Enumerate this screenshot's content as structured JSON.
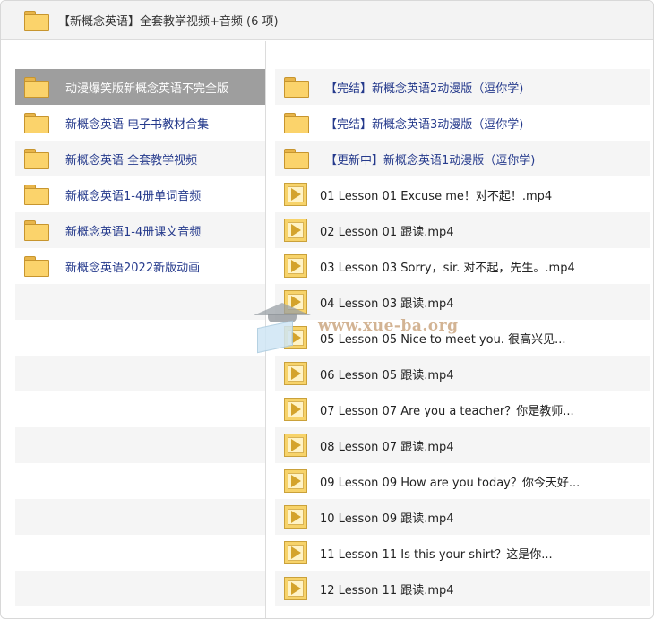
{
  "header": {
    "title": "【新概念英语】全套教学视频+音频 (6 项)",
    "icon": "folder-icon"
  },
  "colors": {
    "folder_fill": "#fbd36b",
    "folder_border": "#c7952e",
    "link_text": "#253a8c",
    "selected_bg": "#9e9e9e",
    "alt_row_bg": "#f5f5f5"
  },
  "left_pane": {
    "items": [
      {
        "label": "动漫爆笑版新概念英语不完全版",
        "icon": "folder-icon",
        "selected": true
      },
      {
        "label": "新概念英语 电子书教材合集",
        "icon": "folder-icon"
      },
      {
        "label": "新概念英语 全套教学视频",
        "icon": "folder-icon"
      },
      {
        "label": "新概念英语1-4册单词音频",
        "icon": "folder-icon"
      },
      {
        "label": "新概念英语1-4册课文音频",
        "icon": "folder-icon"
      },
      {
        "label": "新概念英语2022新版动画",
        "icon": "folder-icon"
      }
    ]
  },
  "right_pane": {
    "items": [
      {
        "label": "【完结】新概念英语2动漫版（逗你学)",
        "icon": "folder-icon"
      },
      {
        "label": "【完结】新概念英语3动漫版（逗你学)",
        "icon": "folder-icon"
      },
      {
        "label": "【更新中】新概念英语1动漫版（逗你学)",
        "icon": "folder-icon"
      },
      {
        "label": "01 Lesson 01 Excuse me！对不起！.mp4",
        "icon": "video-file-icon"
      },
      {
        "label": "02 Lesson 01 跟读.mp4",
        "icon": "video-file-icon"
      },
      {
        "label": "03 Lesson 03 Sorry，sir. 对不起，先生。.mp4",
        "icon": "video-file-icon"
      },
      {
        "label": "04 Lesson 03 跟读.mp4",
        "icon": "video-file-icon"
      },
      {
        "label": "05 Lesson 05 Nice to meet you. 很高兴见...",
        "icon": "video-file-icon"
      },
      {
        "label": "06 Lesson 05 跟读.mp4",
        "icon": "video-file-icon"
      },
      {
        "label": "07 Lesson 07 Are you a teacher？你是教师...",
        "icon": "video-file-icon"
      },
      {
        "label": "08 Lesson 07 跟读.mp4",
        "icon": "video-file-icon"
      },
      {
        "label": "09 Lesson 09 How are you today？你今天好...",
        "icon": "video-file-icon"
      },
      {
        "label": "10 Lesson 09 跟读.mp4",
        "icon": "video-file-icon"
      },
      {
        "label": "11 Lesson 11 Is this your shirt？这是你...",
        "icon": "video-file-icon"
      },
      {
        "label": "12 Lesson 11 跟读.mp4",
        "icon": "video-file-icon"
      }
    ]
  },
  "watermark": {
    "text": "www.xue-ba.org",
    "icon": "graduation-cap-icon"
  }
}
